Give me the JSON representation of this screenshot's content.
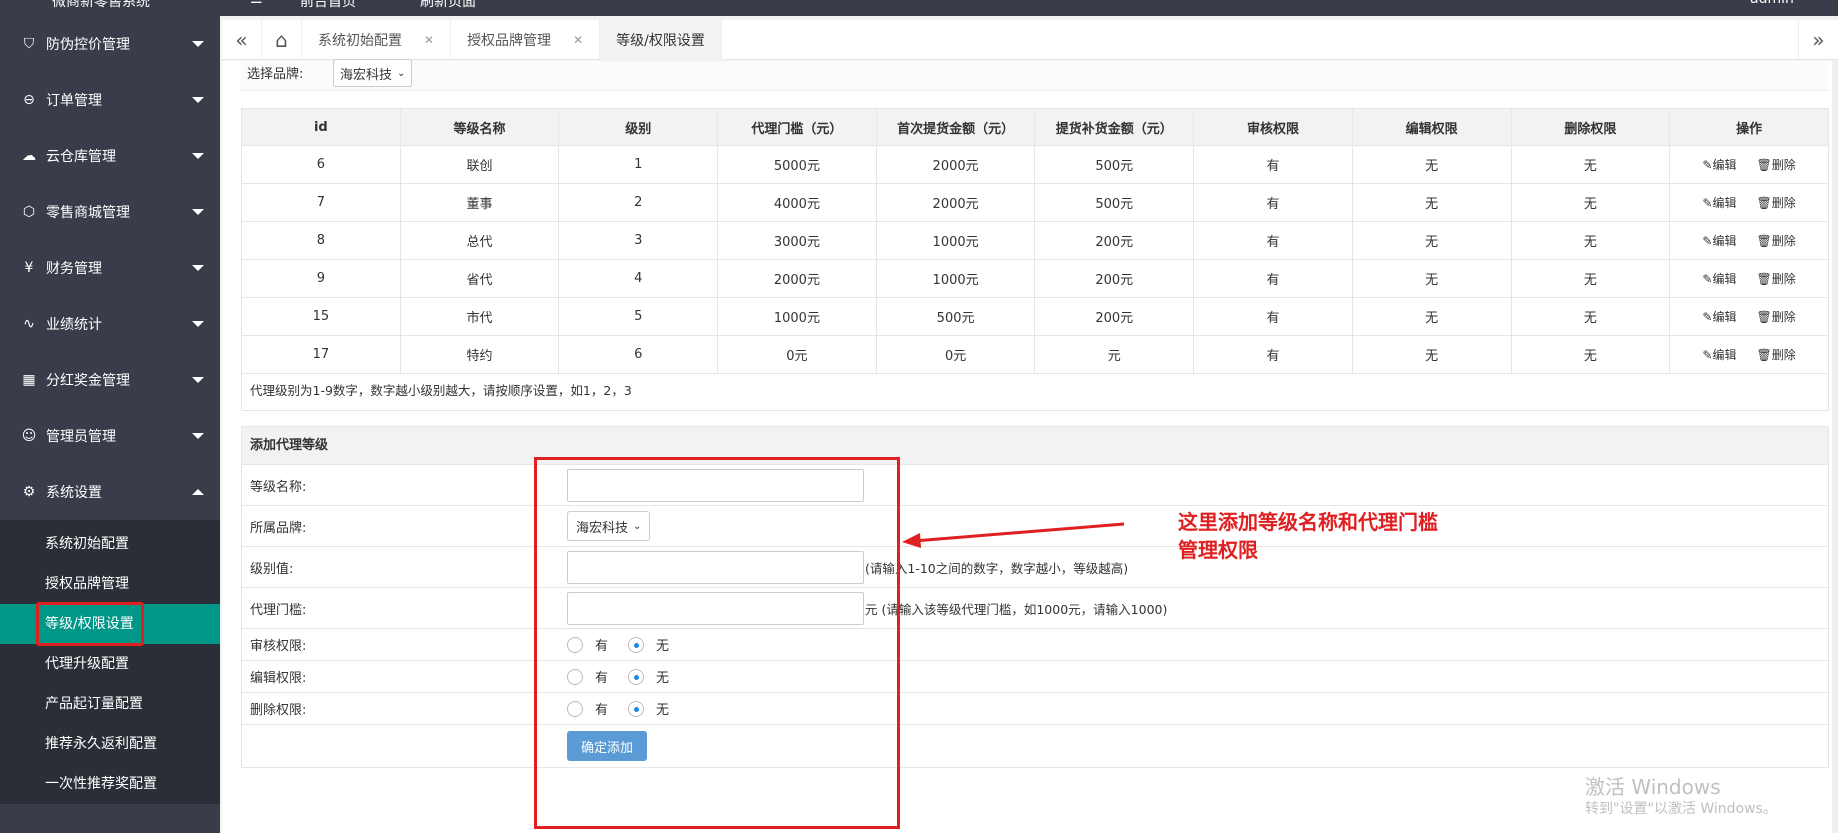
{
  "topbar": {
    "brand": "微商新零售系统",
    "home": "前台首页",
    "refresh": "刷新页面",
    "user": "admin"
  },
  "sidebar": {
    "items": [
      {
        "label": "防伪控价管理",
        "icon": "shield-icon"
      },
      {
        "label": "订单管理",
        "icon": "order-icon"
      },
      {
        "label": "云仓库管理",
        "icon": "cloud-icon"
      },
      {
        "label": "零售商城管理",
        "icon": "cube-icon"
      },
      {
        "label": "财务管理",
        "icon": "yen-icon"
      },
      {
        "label": "业绩统计",
        "icon": "pulse-icon"
      },
      {
        "label": "分红奖金管理",
        "icon": "grid-icon"
      },
      {
        "label": "管理员管理",
        "icon": "user-icon"
      },
      {
        "label": "系统设置",
        "icon": "gear-icon"
      }
    ],
    "submenu": [
      "系统初始配置",
      "授权品牌管理",
      "等级/权限设置",
      "代理升级配置",
      "产品起订量配置",
      "推荐永久返利配置",
      "一次性推荐奖配置"
    ]
  },
  "tabs": [
    "系统初始配置",
    "授权品牌管理",
    "等级/权限设置"
  ],
  "brand_filter": {
    "label": "选择品牌:",
    "value": "海宏科技"
  },
  "table": {
    "headers": [
      "id",
      "等级名称",
      "级别",
      "代理门槛（元）",
      "首次提货金额（元）",
      "提货补货金额（元）",
      "审核权限",
      "编辑权限",
      "删除权限",
      "操作"
    ],
    "rows": [
      [
        "6",
        "联创",
        "1",
        "5000元",
        "2000元",
        "500元",
        "有",
        "无",
        "无"
      ],
      [
        "7",
        "董事",
        "2",
        "4000元",
        "2000元",
        "500元",
        "有",
        "无",
        "无"
      ],
      [
        "8",
        "总代",
        "3",
        "3000元",
        "1000元",
        "200元",
        "有",
        "无",
        "无"
      ],
      [
        "9",
        "省代",
        "4",
        "2000元",
        "1000元",
        "200元",
        "有",
        "无",
        "无"
      ],
      [
        "15",
        "市代",
        "5",
        "1000元",
        "500元",
        "200元",
        "有",
        "无",
        "无"
      ],
      [
        "17",
        "特约",
        "6",
        "0元",
        "0元",
        "元",
        "有",
        "无",
        "无"
      ]
    ],
    "edit_label": "编辑",
    "delete_label": "删除",
    "note": "代理级别为1-9数字，数字越小级别越大，请按顺序设置，如1，2，3"
  },
  "form": {
    "title": "添加代理等级",
    "name_label": "等级名称:",
    "brand_label": "所属品牌:",
    "brand_value": "海宏科技",
    "level_label": "级别值:",
    "level_hint": "(请输入1-10之间的数字，数字越小，等级越高)",
    "threshold_label": "代理门槛:",
    "threshold_hint": "元 (请输入该等级代理门槛，如1000元，请输入1000)",
    "audit_label": "审核权限:",
    "edit_label": "编辑权限:",
    "delete_label": "删除权限:",
    "yes": "有",
    "no": "无",
    "submit": "确定添加"
  },
  "annotation": {
    "line1": "这里添加等级名称和代理门槛",
    "line2": "管理权限"
  },
  "watermark": {
    "line1": "激活 Windows",
    "line2": "转到\"设置\"以激活 Windows。"
  },
  "colors": {
    "sidebar": "#393d49",
    "active": "#009688",
    "annotation": "#e02020",
    "button": "#5b9bd5"
  }
}
